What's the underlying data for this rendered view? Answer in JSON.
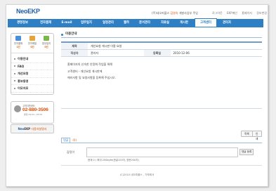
{
  "app": {
    "logo_prefix": "Neo",
    "logo_suffix": "EKP",
    "user_prefix": "(주)네오피플스",
    "user_name": "김영숙",
    "user_suffix": "개발사업부 주임"
  },
  "toplinks": [
    "로그아웃",
    "EKP메인",
    "홈페이지",
    "정보변경"
  ],
  "nav": [
    {
      "label": "경영정보",
      "active": false
    },
    {
      "label": "전자결재",
      "active": false
    },
    {
      "label": "E-mail",
      "active": false
    },
    {
      "label": "업무일지",
      "active": false
    },
    {
      "label": "일정관리",
      "active": false
    },
    {
      "label": "웹하",
      "active": false
    },
    {
      "label": "문서관리",
      "active": false
    },
    {
      "label": "자료실",
      "active": false
    },
    {
      "label": "게시판",
      "active": false
    },
    {
      "label": "고객센터",
      "active": true
    },
    {
      "label": "관리자",
      "active": false
    }
  ],
  "sidebar": {
    "stats": [
      {
        "label": "전자결재",
        "count": "1건",
        "color": "#4a90d9"
      },
      {
        "label": "전자메일",
        "count": "0건",
        "color": "#e8a23a"
      },
      {
        "label": "업무일지",
        "count": "0건",
        "color": "#7ab648"
      }
    ],
    "menu": [
      "이용안내",
      "FAQ",
      "개선요청",
      "홍보동영",
      "이모저모"
    ],
    "call": {
      "label": "고객지원센터",
      "number": "02-880-3506",
      "hours": "평일 09:00~18:00"
    },
    "banner": {
      "neo": "Neo",
      "ekp": "EKP",
      "rest": " 사용자설명서"
    }
  },
  "content": {
    "section_title": "이용안내",
    "table": {
      "subject_label": "제목",
      "subject_value": "개선요청 게시판 이용 요청",
      "author_label": "작성자",
      "author_value": "관리자",
      "date_label": "등록일",
      "date_value": "2010-12-06"
    },
    "body_lines": [
      "홈페이지의 신속한 안정화 작업을 위해",
      "고객센터 - 개선요청 게시판에",
      "에러사항 및 요청사항을 등록해 주십시오."
    ],
    "buttons": {
      "list": "목록",
      "print": "인쇄"
    },
    "comments": {
      "tab_label": "댓글",
      "count": "(0)",
      "input_label": "감정이",
      "submit": "댓글 등록",
      "char_count": "현재 0 / 최대 250byte(한글125자, 영문250자)"
    }
  },
  "footer": "(C)2010 네오피플스 , 가뿌레서"
}
